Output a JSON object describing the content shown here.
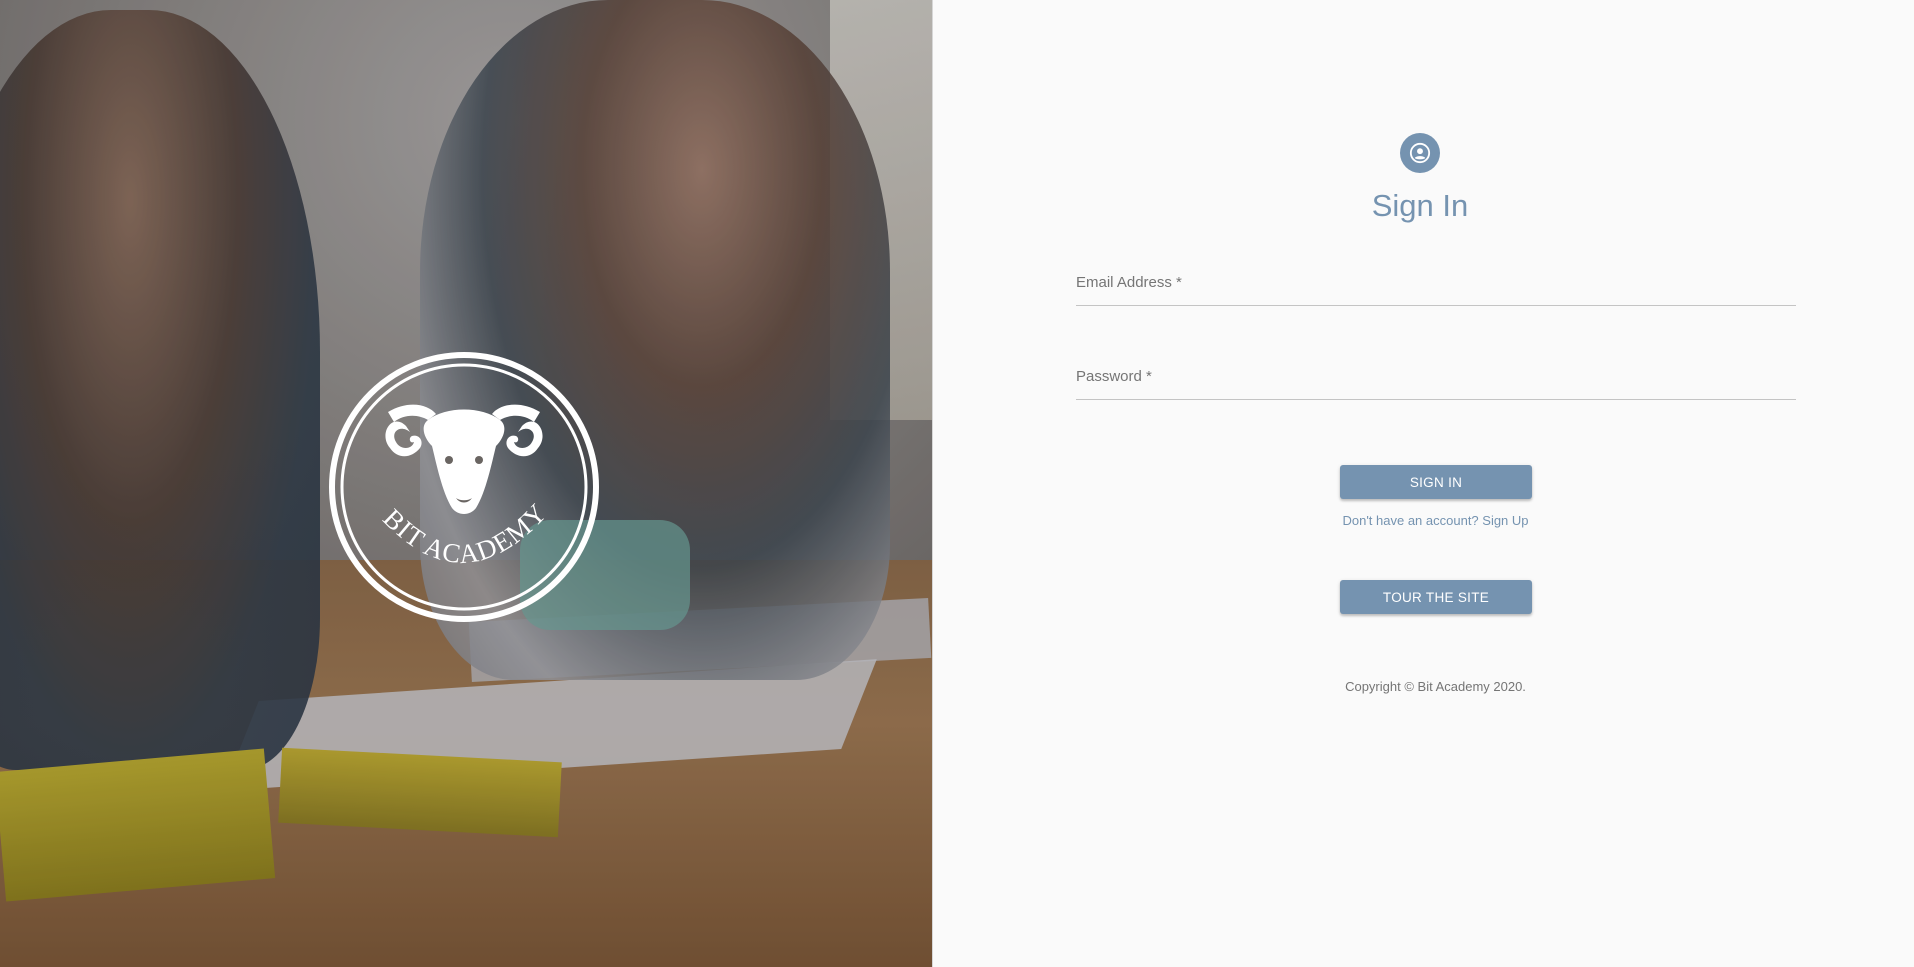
{
  "hero": {
    "logo_text": "BIT ACADEMY",
    "logo_icon": "ram-head-icon"
  },
  "form": {
    "avatar_icon": "account-circle-icon",
    "title": "Sign In",
    "email": {
      "label": "Email Address *",
      "value": ""
    },
    "password": {
      "label": "Password *",
      "value": ""
    },
    "signin_label": "SIGN IN",
    "signup_link": "Don't have an account? Sign Up",
    "tour_label": "TOUR THE SITE",
    "copyright": "Copyright © Bit Academy 2020."
  },
  "colors": {
    "accent": "#7593b0",
    "background": "#fafafa",
    "label": "#757575"
  }
}
